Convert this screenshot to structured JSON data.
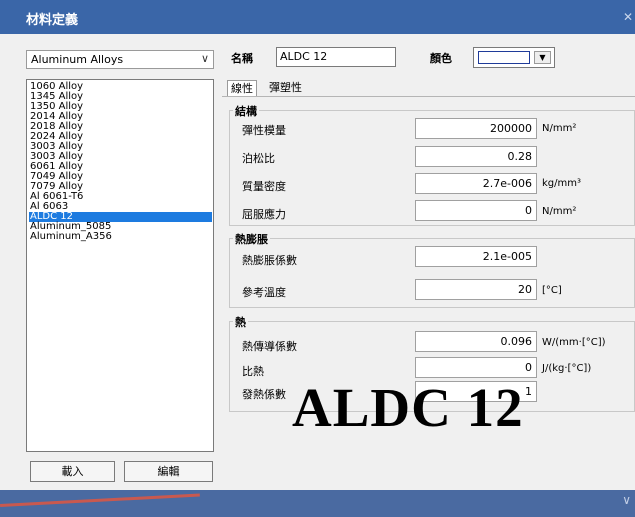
{
  "window": {
    "title": "材料定義",
    "close_glyph": "✕"
  },
  "library": {
    "selected": "Aluminum Alloys",
    "items": [
      "1060 Alloy",
      "1345 Alloy",
      "1350 Alloy",
      "2014 Alloy",
      "2018 Alloy",
      "2024 Alloy",
      "3003 Alloy",
      "3003 Alloy",
      "6061 Alloy",
      "7049 Alloy",
      "7079 Alloy",
      "Al 6061-T6",
      "Al 6063",
      "ALDC 12",
      "Aluminum_5085",
      "Aluminum_A356"
    ],
    "selected_item": "ALDC 12"
  },
  "buttons": {
    "load": "載入",
    "edit": "編輯"
  },
  "header": {
    "name_label": "名稱",
    "name_value": "ALDC 12",
    "color_label": "顏色"
  },
  "tabs": [
    "線性",
    "彈塑性"
  ],
  "structure": {
    "title": "結構",
    "rows": [
      {
        "label": "彈性模量",
        "value": "200000",
        "unit": "N/mm²"
      },
      {
        "label": "泊松比",
        "value": "0.28",
        "unit": ""
      },
      {
        "label": "質量密度",
        "value": "2.7e-006",
        "unit": "kg/mm³"
      },
      {
        "label": "屈服應力",
        "value": "0",
        "unit": "N/mm²"
      }
    ]
  },
  "thermal_expansion": {
    "title": "熱膨脹",
    "rows": [
      {
        "label": "熱膨脹係數",
        "value": "2.1e-005",
        "unit": ""
      },
      {
        "label": "參考溫度",
        "value": "20",
        "unit": "[°C]"
      }
    ]
  },
  "heat": {
    "title": "熱",
    "rows": [
      {
        "label": "熱傳導係數",
        "value": "0.096",
        "unit": "W/(mm·[°C])"
      },
      {
        "label": "比熱",
        "value": "0",
        "unit": "J/(kg·[°C])"
      },
      {
        "label": "發熱係數",
        "value": "1",
        "unit": ""
      }
    ]
  },
  "overlay_text": "ALDC 12",
  "colors": {
    "titlebar": "#3a66a8",
    "selection": "#1d7be0",
    "footer": "#4a6aa1",
    "annotation_line": "#c9594f"
  }
}
